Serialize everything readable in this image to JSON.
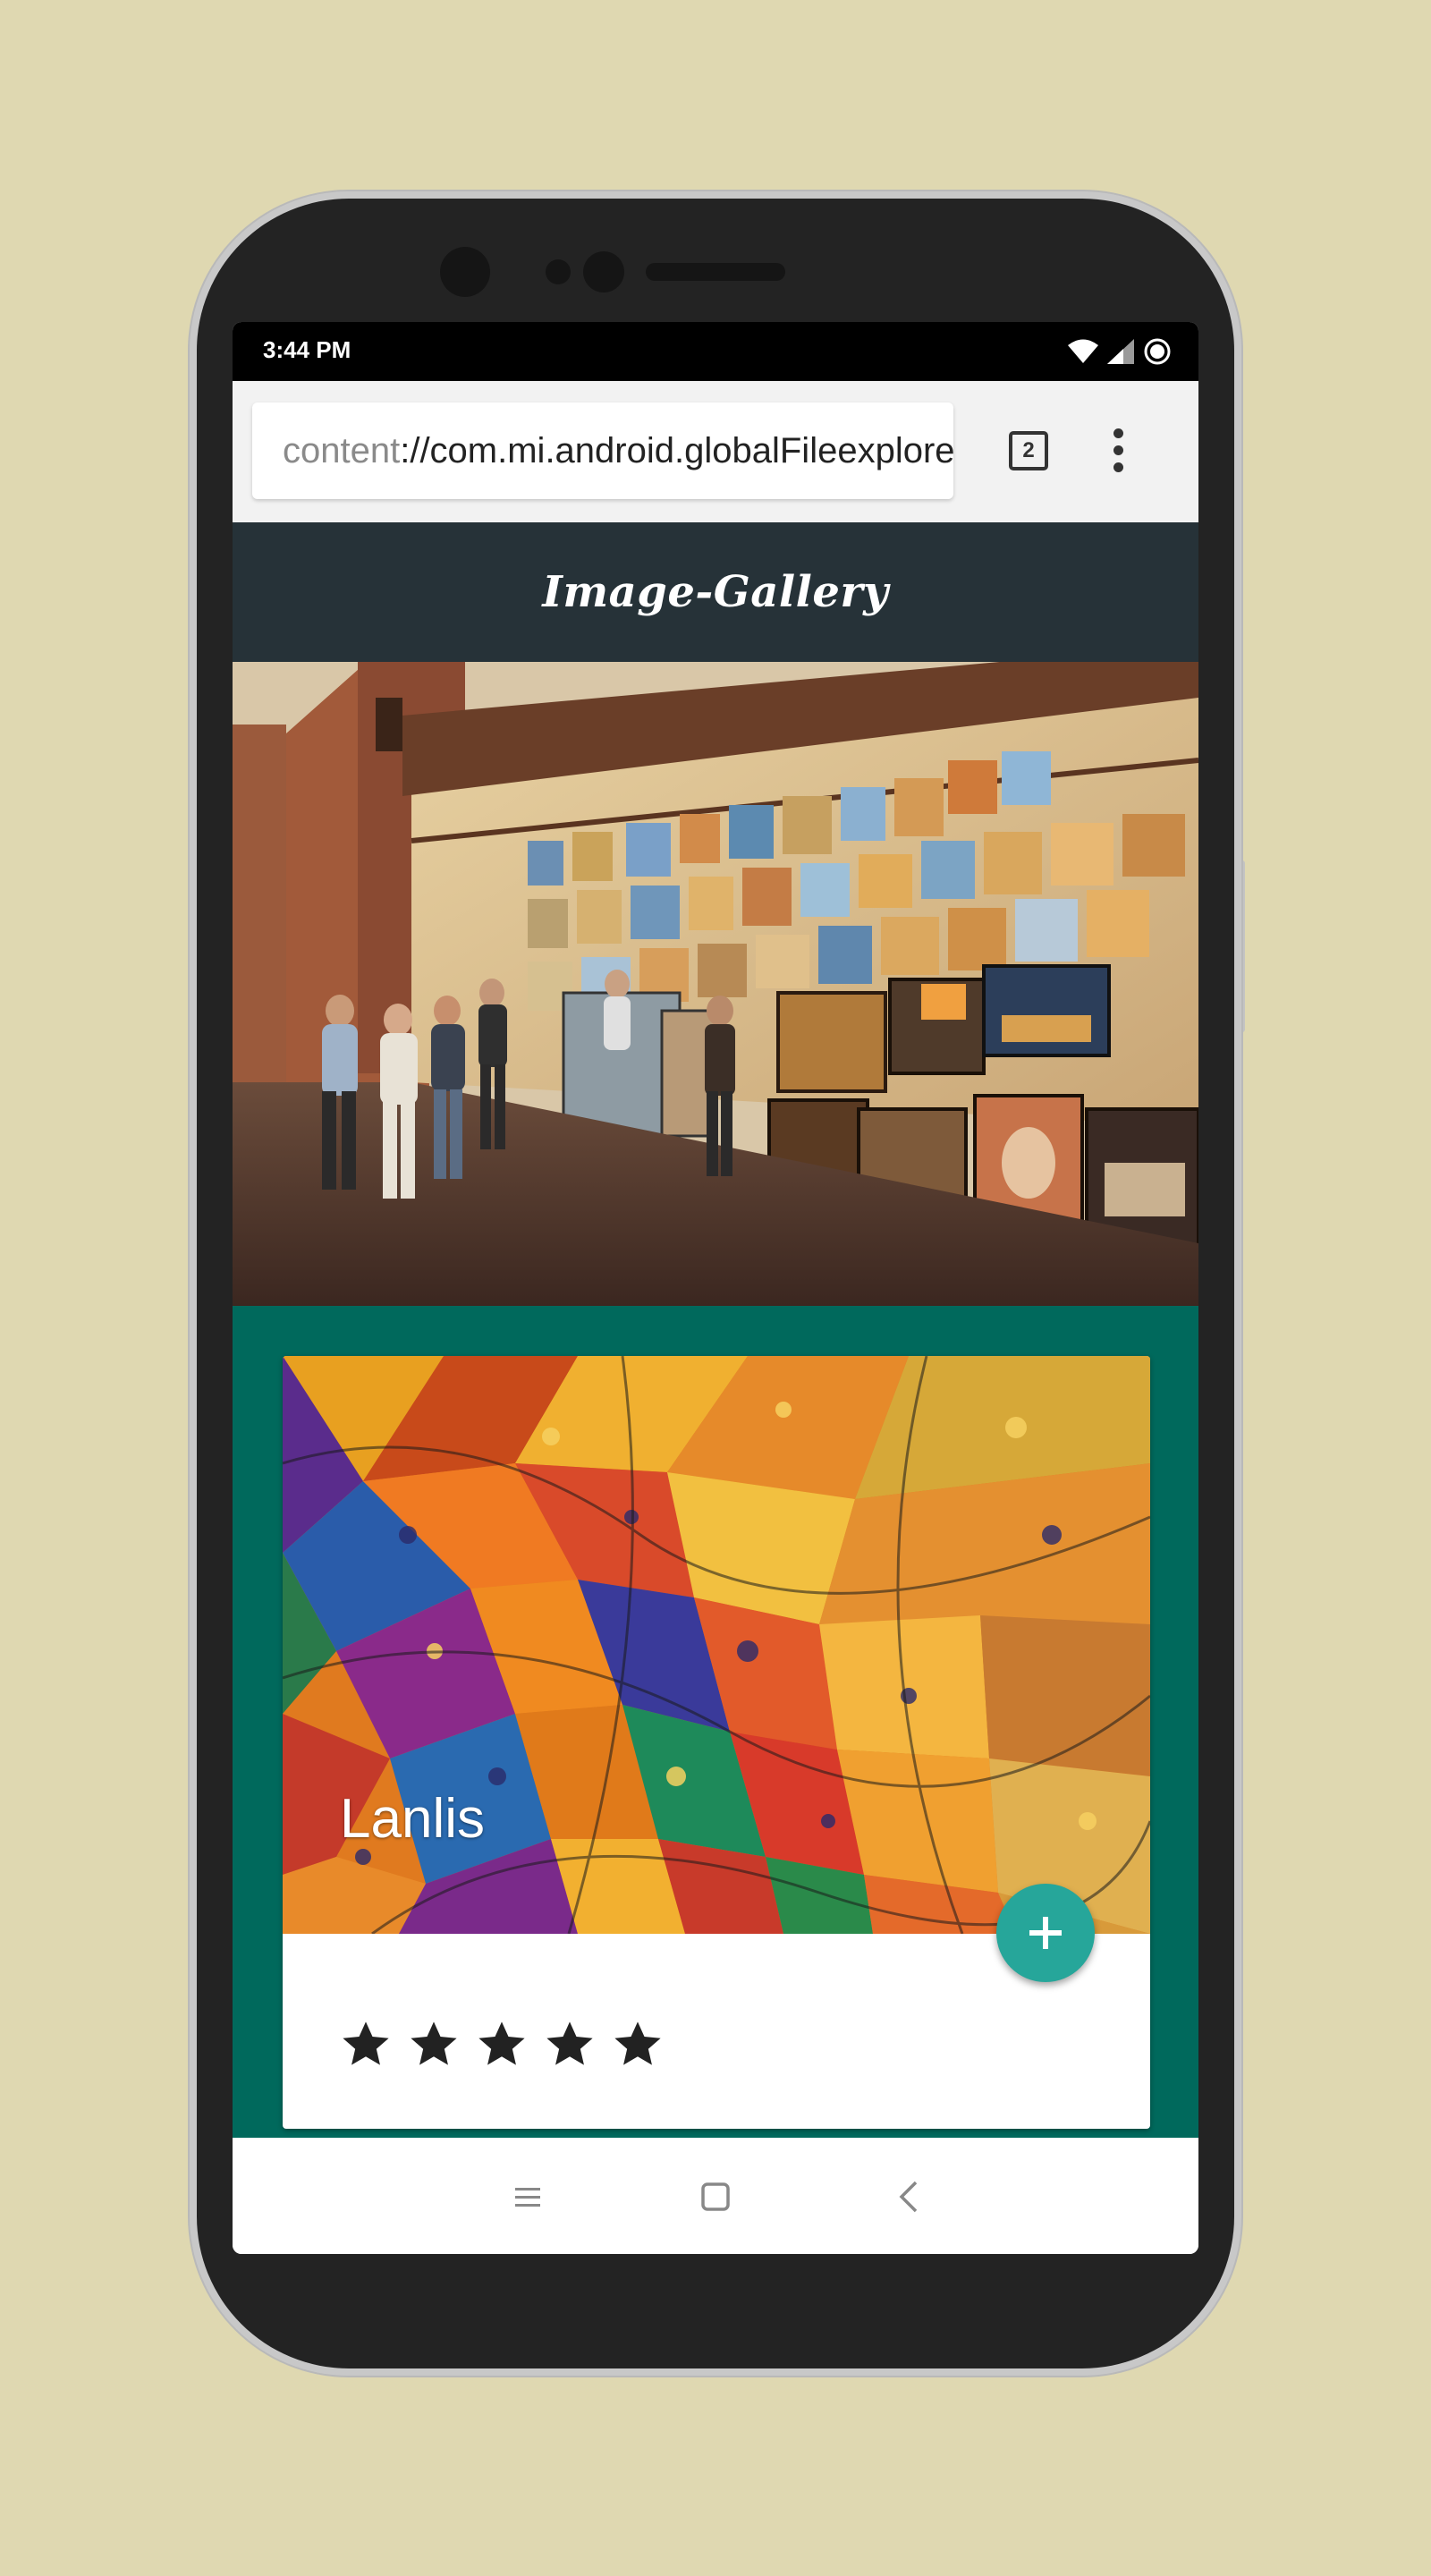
{
  "status_bar": {
    "time": "3:44 PM",
    "icons": [
      "wifi-icon",
      "signal-icon",
      "data-saver-icon"
    ]
  },
  "browser": {
    "url_scheme": "content",
    "url_rest": "://com.mi.android.globalFileexplorer",
    "tab_count": "2",
    "menu_icon": "more-vert-icon"
  },
  "app": {
    "title": "Image-Gallery"
  },
  "card": {
    "title": "Lanlis",
    "fab_icon": "plus-icon",
    "rating": 5,
    "rating_max": 5
  },
  "nav_bar": {
    "icons": [
      "menu-icon",
      "home-icon",
      "back-icon"
    ]
  },
  "colors": {
    "background": "#dfd8b1",
    "app_header": "#263238",
    "card_section": "#00695c",
    "fab": "#26a69a"
  }
}
